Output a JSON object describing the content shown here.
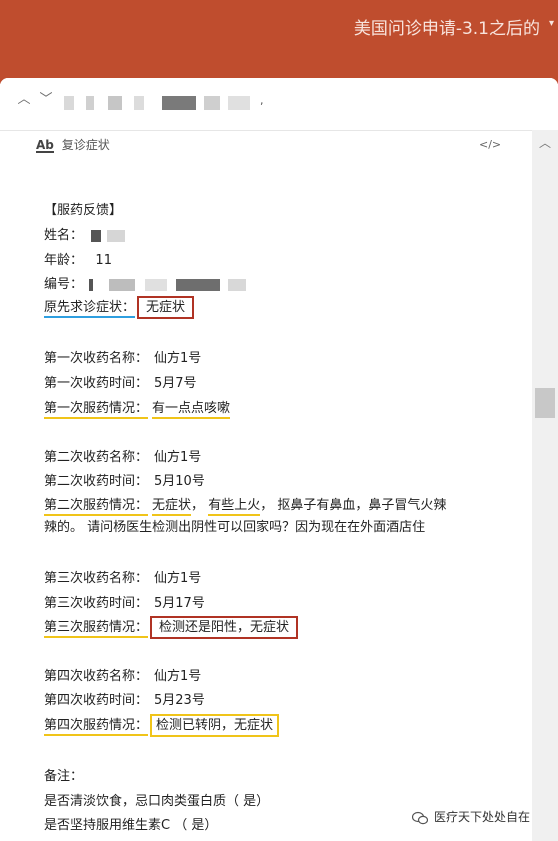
{
  "window": {
    "title": "美国问诊申请-3.1之后的"
  },
  "mail": {
    "label": "复诊症状"
  },
  "content": {
    "heading": "【服药反馈】",
    "name_label": "姓名：",
    "age_label": "年龄：",
    "age_value": "11",
    "id_label": "编号：",
    "original_symptom_label": "原先求诊症状：",
    "original_symptom_value": "无症状",
    "rounds": [
      {
        "name_label": "第一次收药名称：",
        "name_value": "仙方1号",
        "time_label": "第一次收药时间：",
        "time_value": "5月7号",
        "status_label": "第一次服药情况：",
        "status_value": "有一点点咳嗽"
      },
      {
        "name_label": "第二次收药名称：",
        "name_value": "仙方1号",
        "time_label": "第二次收药时间：",
        "time_value": "5月10号",
        "status_label": "第二次服药情况：",
        "status_value_a": "无症状",
        "status_value_b": "有些上火",
        "status_value_c": "抠鼻子有鼻血，鼻子冒气火辣",
        "status_line2": "辣的。 请问杨医生检测出阴性可以回家吗？因为现在在外面酒店住"
      },
      {
        "name_label": "第三次收药名称：",
        "name_value": "仙方1号",
        "time_label": "第三次收药时间：",
        "time_value": "5月17号",
        "status_label": "第三次服药情况：",
        "status_value": "检测还是阳性，无症状"
      },
      {
        "name_label": "第四次收药名称：",
        "name_value": "仙方1号",
        "time_label": "第四次收药时间：",
        "time_value": "5月23号",
        "status_label": "第四次服药情况：",
        "status_value": "检测已转阴，无症状"
      }
    ],
    "notes_label": "备注：",
    "note_1": "是否清淡饮食，忌口肉类蛋白质（ 是）",
    "note_2": "是否坚持服用维生素C （ 是）"
  },
  "watermark": {
    "text": "医疗天下处处自在"
  },
  "colors": {
    "titlebar": "#bf4d2e",
    "highlight_yellow": "#f0c419",
    "highlight_blue": "#2f9fe0",
    "box_red": "#b03324"
  }
}
